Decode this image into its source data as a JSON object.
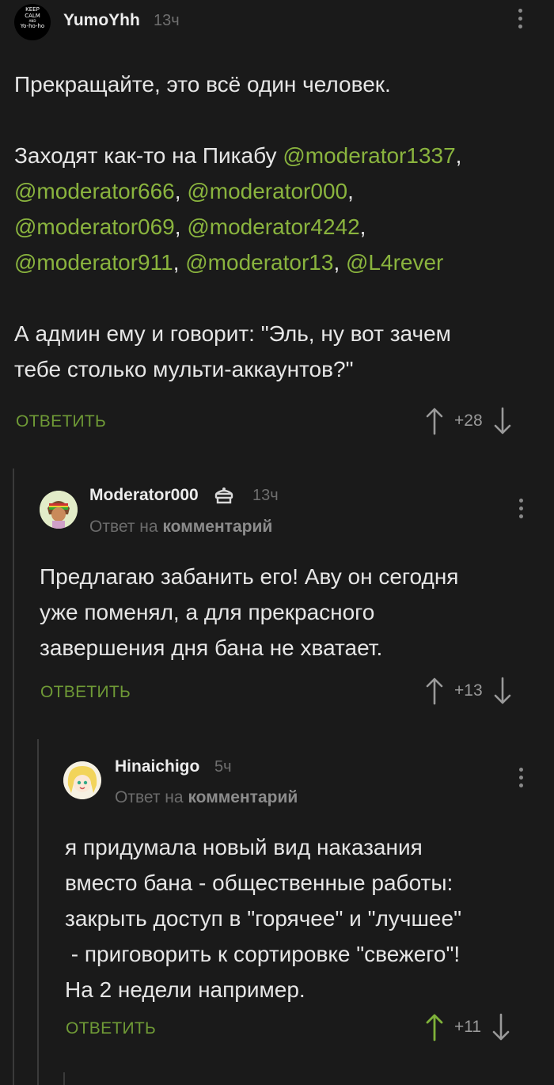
{
  "comments": [
    {
      "author": "YumoYhh",
      "time": "13ч",
      "avatar_text": [
        "KEEP",
        "CALM",
        "AND",
        "Yo-ho-ho"
      ],
      "para1": "Прекращайте, это всё один человек.",
      "para2_line1_text": "Заходят как-то на Пикабу ",
      "mentions": [
        "@moderator1337",
        "@moderator666",
        "@moderator000",
        "@moderator069",
        "@moderator4242",
        "@moderator911",
        "@moderator13",
        "@L4rever"
      ],
      "para3_line1": "А админ ему и говорит: \"Эль, ну вот зачем",
      "para3_line2": "тебе столько мульти-аккаунтов?\"",
      "reply_label": "ОТВЕТИТЬ",
      "score": "+28"
    },
    {
      "author": "Moderator000",
      "time": "13ч",
      "reply_prefix": "Ответ на",
      "reply_target": "комментарий",
      "lines": [
        "Предлагаю забанить его! Аву он сегодня",
        "уже поменял, а для прекрасного",
        "завершения дня бана не хватает."
      ],
      "reply_label": "ОТВЕТИТЬ",
      "score": "+13"
    },
    {
      "author": "Hinaichigo",
      "time": "5ч",
      "reply_prefix": "Ответ на",
      "reply_target": "комментарий",
      "lines": [
        "я придумала новый вид наказания",
        "вместо бана - общественные работы:",
        "закрыть доступ в \"горячее\" и \"лучшее\"",
        " - приговорить к сортировке \"свежего\"!",
        "На 2 недели например."
      ],
      "reply_label": "ОТВЕТИТЬ",
      "score": "+11"
    }
  ],
  "colors": {
    "background": "#1a1a1a",
    "accent": "#8ab43e",
    "reply": "#6f9a36",
    "upvote_active": "#7fb23a"
  },
  "icons": {
    "moderator_badge": "moderator-badge-icon",
    "menu": "kebab-menu-icon",
    "up": "arrow-up-icon",
    "down": "arrow-down-icon"
  }
}
